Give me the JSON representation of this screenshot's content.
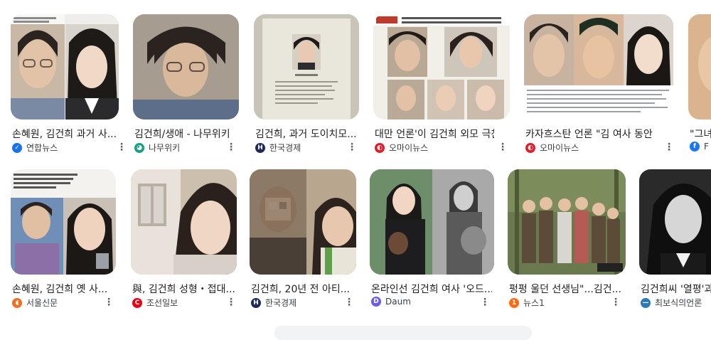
{
  "results": [
    {
      "title": "손혜원, 김건희 과거 사...",
      "source": "연합뉴스",
      "icon": "yonhap-favicon-icon",
      "icon_color": "#1a73e8",
      "icon_glyph": "✓"
    },
    {
      "title": "김건희/생애 - 나무위키",
      "source": "나무위키",
      "icon": "namuwiki-favicon-icon",
      "icon_color": "#16a085",
      "icon_glyph": "◕"
    },
    {
      "title": "김건희, 과거 도이치모...",
      "source": "한국경제",
      "icon": "hankyung-favicon-icon",
      "icon_color": "#1f2a5a",
      "icon_glyph": "H"
    },
    {
      "title": "대만 언론'이 김건희 외모 극찬...",
      "source": "오마이뉴스",
      "icon": "ohmynews-favicon-icon",
      "icon_color": "#e21d2a",
      "icon_glyph": "◐"
    },
    {
      "title": "카자흐스탄 언론 \"김 여사 동안 외...",
      "source": "오마이뉴스",
      "icon": "ohmynews-favicon-icon",
      "icon_color": "#e21d2a",
      "icon_glyph": "◐"
    },
    {
      "title": "\"그녀",
      "source": "F",
      "icon": "facebook-favicon-icon",
      "icon_color": "#1877f2",
      "icon_glyph": "f"
    },
    {
      "title": "손혜원, 김건희 옛 사...",
      "source": "서울신문",
      "icon": "seoul-shinmun-favicon-icon",
      "icon_color": "#f36f21",
      "icon_glyph": "◖"
    },
    {
      "title": "與, 김건희 성형・접대...",
      "source": "조선일보",
      "icon": "chosun-favicon-icon",
      "icon_color": "#e60012",
      "icon_glyph": "C"
    },
    {
      "title": "김건희, 20년 전 아티...",
      "source": "한국경제",
      "icon": "hankyung-favicon-icon",
      "icon_color": "#1f2a5a",
      "icon_glyph": "H"
    },
    {
      "title": "온라인선 김건희 여사 '오드...",
      "source": "Daum",
      "icon": "daum-favicon-icon",
      "icon_color": "#6c5ce7",
      "icon_glyph": "D"
    },
    {
      "title": "펑펑 울던 선생님\"...김건...",
      "source": "뉴스1",
      "icon": "news1-favicon-icon",
      "icon_color": "#ff6a13",
      "icon_glyph": "1"
    },
    {
      "title": "김건희씨 '열평'과",
      "source": "최보식의언론",
      "icon": "choiboshik-favicon-icon",
      "icon_color": "#2a7ab8",
      "icon_glyph": "—"
    }
  ],
  "ui": {
    "more_glyph": "⋮"
  }
}
